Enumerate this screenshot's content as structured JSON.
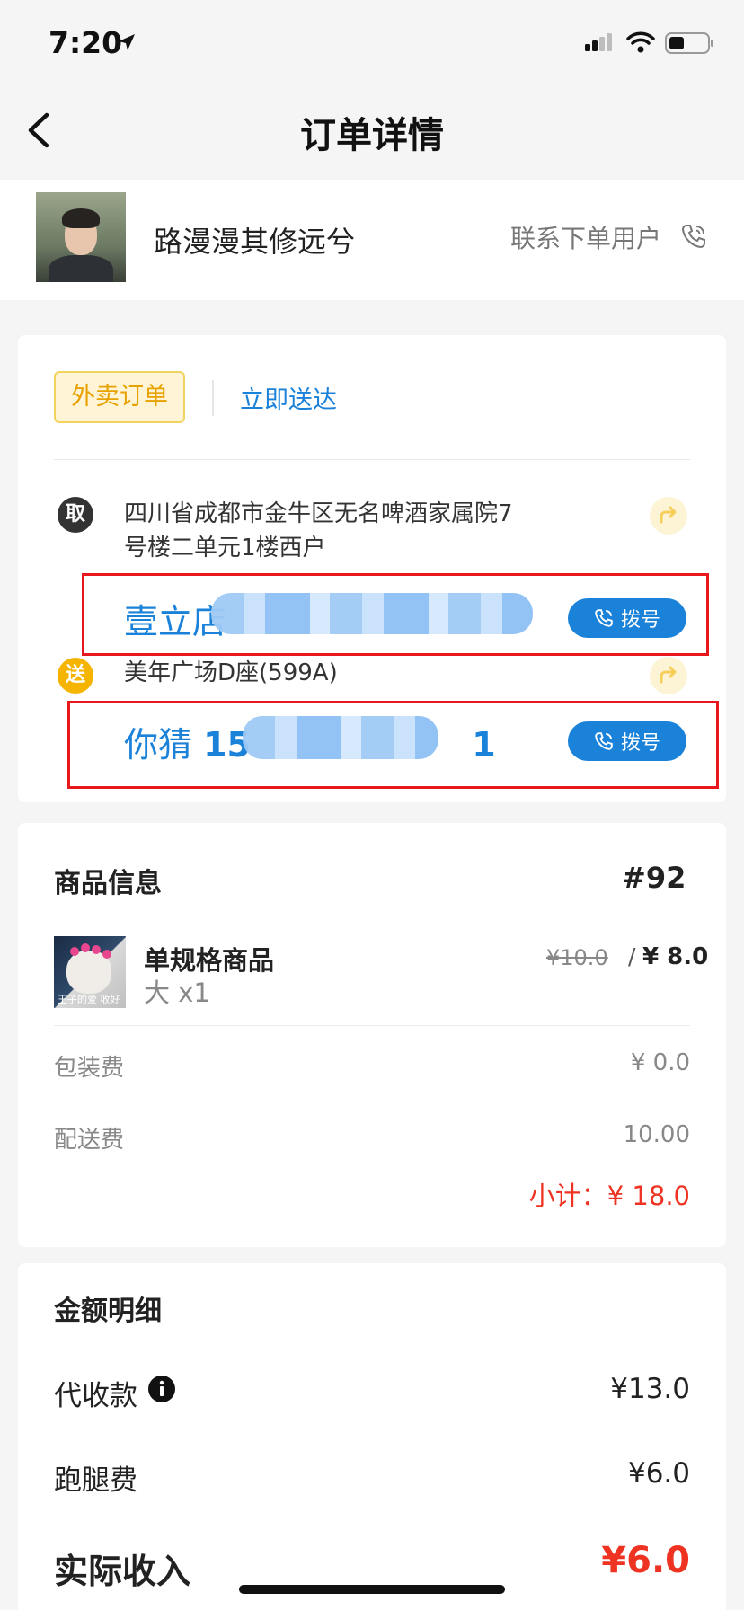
{
  "status_bar": {
    "time": "7:20"
  },
  "header": {
    "title": "订单详情"
  },
  "customer": {
    "name": "路漫漫其修远兮",
    "contact_label": "联系下单用户"
  },
  "order": {
    "tags": {
      "type": "外卖订单",
      "delivery": "立即送达"
    },
    "pickup": {
      "badge": "取",
      "address_line1": "四川省成都市金牛区无名啤酒家属院7",
      "address_line2": "号楼二单元1楼西户",
      "contact": "壹立店",
      "dial_label": "拨号"
    },
    "dropoff": {
      "badge": "送",
      "address": "美年广场D座(599A)",
      "contact_name": "你猜",
      "phone_prefix": "15",
      "phone_suffix": "1",
      "dial_label": "拨号"
    }
  },
  "goods": {
    "title": "商品信息",
    "order_number": "#92",
    "item": {
      "name": "单规格商品",
      "spec": "大 x1",
      "original_price": "¥10.0",
      "separator": "/",
      "price": "¥ 8.0",
      "thumb_caption": "王子的爱 收好"
    },
    "packing_fee_label": "包装费",
    "packing_fee": "¥ 0.0",
    "delivery_fee_label": "配送费",
    "delivery_fee": "10.00",
    "subtotal": "小计：¥ 18.0"
  },
  "amount": {
    "title": "金额明细",
    "cod_label": "代收款",
    "cod_value": "¥13.0",
    "errand_label": "跑腿费",
    "errand_value": "¥6.0",
    "income_label": "实际收入",
    "income_value": "¥6.0"
  },
  "colors": {
    "accent_blue": "#1a82d9",
    "accent_yellow": "#f5b400",
    "price_red": "#ee3322",
    "highlight_red": "#e8161d"
  }
}
